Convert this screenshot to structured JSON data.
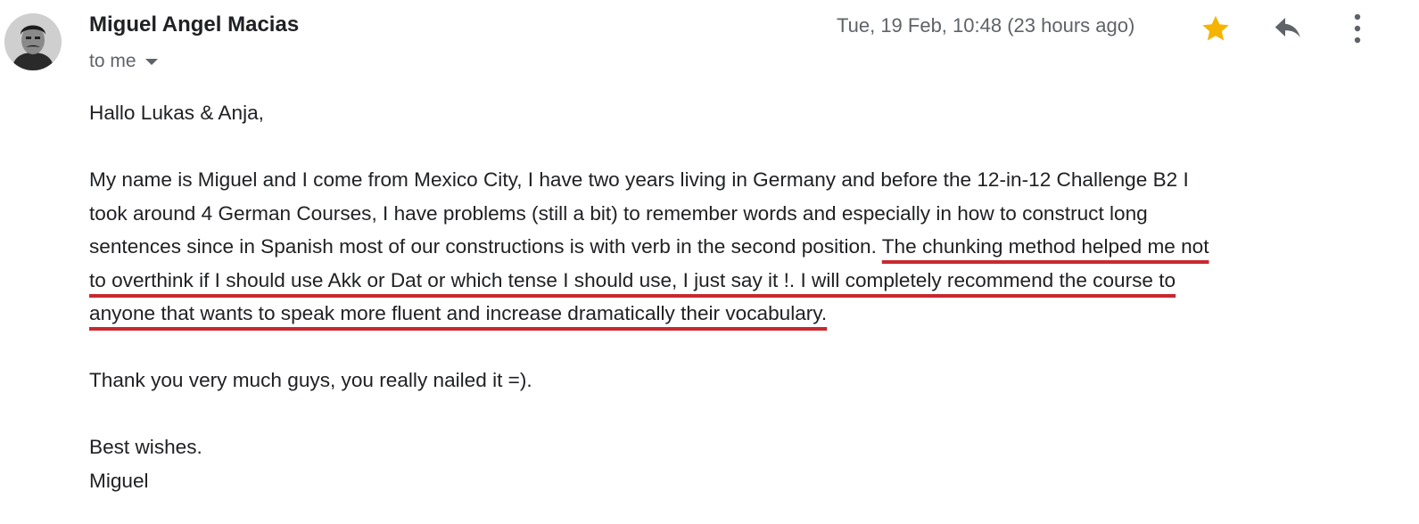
{
  "header": {
    "sender_name": "Miguel Angel Macias",
    "recipient_label": "to me",
    "timestamp": "Tue, 19 Feb, 10:48 (23 hours ago)",
    "star_color": "#f4b400",
    "icons": [
      "avatar",
      "chevron-down-icon",
      "star-icon",
      "reply-icon",
      "more-vert-icon"
    ]
  },
  "message": {
    "greeting": "Hallo Lukas & Anja,",
    "paragraph_lines": [
      "My name is Miguel and I come from Mexico City, I have two years living in Germany and before the 12-in-12 Challenge B2 I",
      "took around 4 German Courses, I have problems (still a bit) to remember words and especially in how to construct long",
      "sentences since in Spanish most of our constructions is with verb in the second position. "
    ],
    "highlight_lines": [
      "The chunking method helped me not",
      "to overthink if I should use Akk or Dat or which tense I should use, I just say it !. I will completely recommend the course to",
      "anyone that wants to speak more fluent and increase dramatically their vocabulary."
    ],
    "highlight_color": "#c8282e",
    "thanks": "Thank you very much guys, you really nailed it =).",
    "closing": "Best wishes.",
    "signature": "Miguel"
  }
}
